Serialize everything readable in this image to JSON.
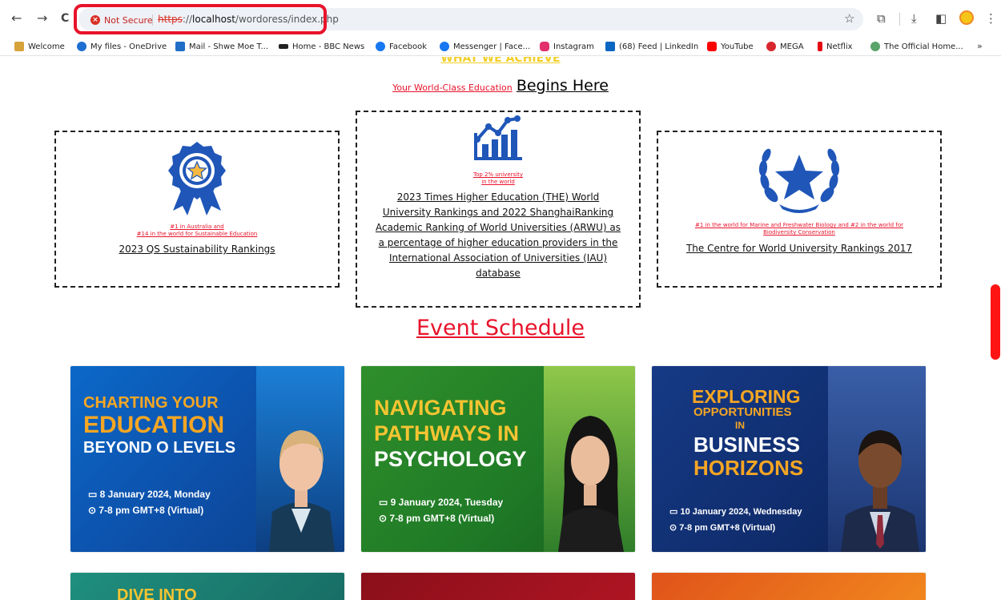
{
  "browser": {
    "nav": {
      "back": "←",
      "forward": "→",
      "reload": "C"
    },
    "security_label": "Not Secure",
    "url_scheme": "https",
    "url_rest_start": "://",
    "url_host": "localhost",
    "url_path": "/wordoress/index.php",
    "icons": {
      "star": "☆",
      "extensions": "⧉",
      "download": "⤓",
      "sidepanel": "◧",
      "menu": "⋮"
    }
  },
  "bookmarks": [
    {
      "label": "Welcome",
      "color": "#d6a23a"
    },
    {
      "label": "My files - OneDrive",
      "color": "#1e6fd1"
    },
    {
      "label": "Mail - Shwe Moe T...",
      "color": "#1f6fc7"
    },
    {
      "label": "Home - BBC News",
      "color": "#222222"
    },
    {
      "label": "Facebook",
      "color": "#1877f2"
    },
    {
      "label": "Messenger | Face...",
      "color": "#1877f2"
    },
    {
      "label": "Instagram",
      "color": "#e1306c"
    },
    {
      "label": "(68) Feed | LinkedIn",
      "color": "#0a66c2"
    },
    {
      "label": "YouTube",
      "color": "#ff0000"
    },
    {
      "label": "MEGA",
      "color": "#d9272e"
    },
    {
      "label": "Netflix",
      "color": "#e50914"
    },
    {
      "label": "The Official Home...",
      "color": "#5aa36b"
    }
  ],
  "bookmarks_more": "»",
  "page": {
    "achieve_heading": "WHAT WE ACHIEVE",
    "subheading_small": "Your World-Class Education",
    "subheading_big": "Begins Here",
    "rankings": [
      {
        "note_line1": "#1 in Australia and",
        "note_line2": "#14 in the world for Sustainable Education",
        "title": "2023 QS Sustainability Rankings"
      },
      {
        "note_line1": "Top 2% university",
        "note_line2": "in the world",
        "title_lines": [
          "2023 Times Higher Education (THE) World",
          "University Rankings and 2022 ShanghaiRanking",
          "Academic Ranking of World Universities (ARWU) as",
          "a percentage of higher education providers in the",
          "International Association of Universities (IAU)",
          "database"
        ]
      },
      {
        "note_line1": "#1 in the world for Marine and Freshwater Biology and #2 in the world for",
        "note_line2": "Biodiversity Conservation",
        "title": "The Centre for World University Rankings 2017"
      }
    ],
    "event_schedule_title": "Event Schedule",
    "events": [
      {
        "line1": "CHARTING YOUR",
        "line2": "EDUCATION",
        "line3": "BEYOND O LEVELS",
        "date": "8 January 2024, Monday",
        "time": "7-8 pm GMT+8 (Virtual)"
      },
      {
        "line1": "NAVIGATING",
        "line2": "PATHWAYS IN",
        "line3": "PSYCHOLOGY",
        "date": "9 January 2024, Tuesday",
        "time": "7-8 pm GMT+8 (Virtual)"
      },
      {
        "line1": "EXPLORING",
        "line2": "OPPORTUNITIES",
        "line2b": "IN",
        "line3": "BUSINESS",
        "line4": "HORIZONS",
        "date": "10 January 2024, Wednesday",
        "time": "7-8 pm GMT+8 (Virtual)"
      }
    ],
    "next_row_partial": "DIVE INTO",
    "colors": {
      "accent_red": "#e8132b",
      "achieve_yellow": "#f2cf2a",
      "icon_blue": "#1f56b8",
      "headline_orange": "#f5a623"
    }
  }
}
